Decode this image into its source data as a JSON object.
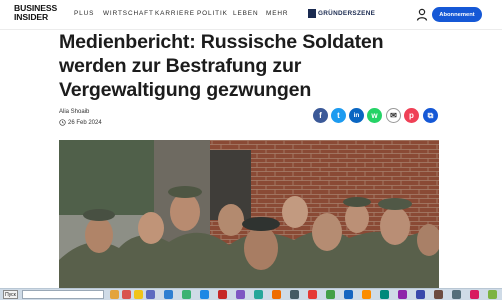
{
  "brand": {
    "line1": "BUSINESS",
    "line2": "INSIDER"
  },
  "nav": {
    "items": [
      "PLUS",
      "WIRTSCHAFT",
      "KARRIERE",
      "POLITIK",
      "LEBEN",
      "MEHR"
    ],
    "partner": "GRÜNDERSZENE",
    "subscribe_label": "Abonnement"
  },
  "article": {
    "headline": "Medienbericht: Russische Soldaten werden zur Bestrafung zur Vergewaltigung gezwungen",
    "author": "Alia Shoaib",
    "date": "26 Feb 2024"
  },
  "share": [
    {
      "icon": "facebook-icon",
      "glyph": "f",
      "color": "#3b5998"
    },
    {
      "icon": "twitter-icon",
      "glyph": "t",
      "color": "#1d9bf0"
    },
    {
      "icon": "linkedin-icon",
      "glyph": "in",
      "color": "#0a66c2"
    },
    {
      "icon": "whatsapp-icon",
      "glyph": "w",
      "color": "#25d366"
    },
    {
      "icon": "email-icon",
      "glyph": "✉",
      "color": "#ffffff"
    },
    {
      "icon": "pocket-icon",
      "glyph": "p",
      "color": "#ef4056"
    },
    {
      "icon": "copy-link-icon",
      "glyph": "⧉",
      "color": "#1558d6"
    }
  ],
  "taskbar": {
    "start_label": "Пуск"
  }
}
